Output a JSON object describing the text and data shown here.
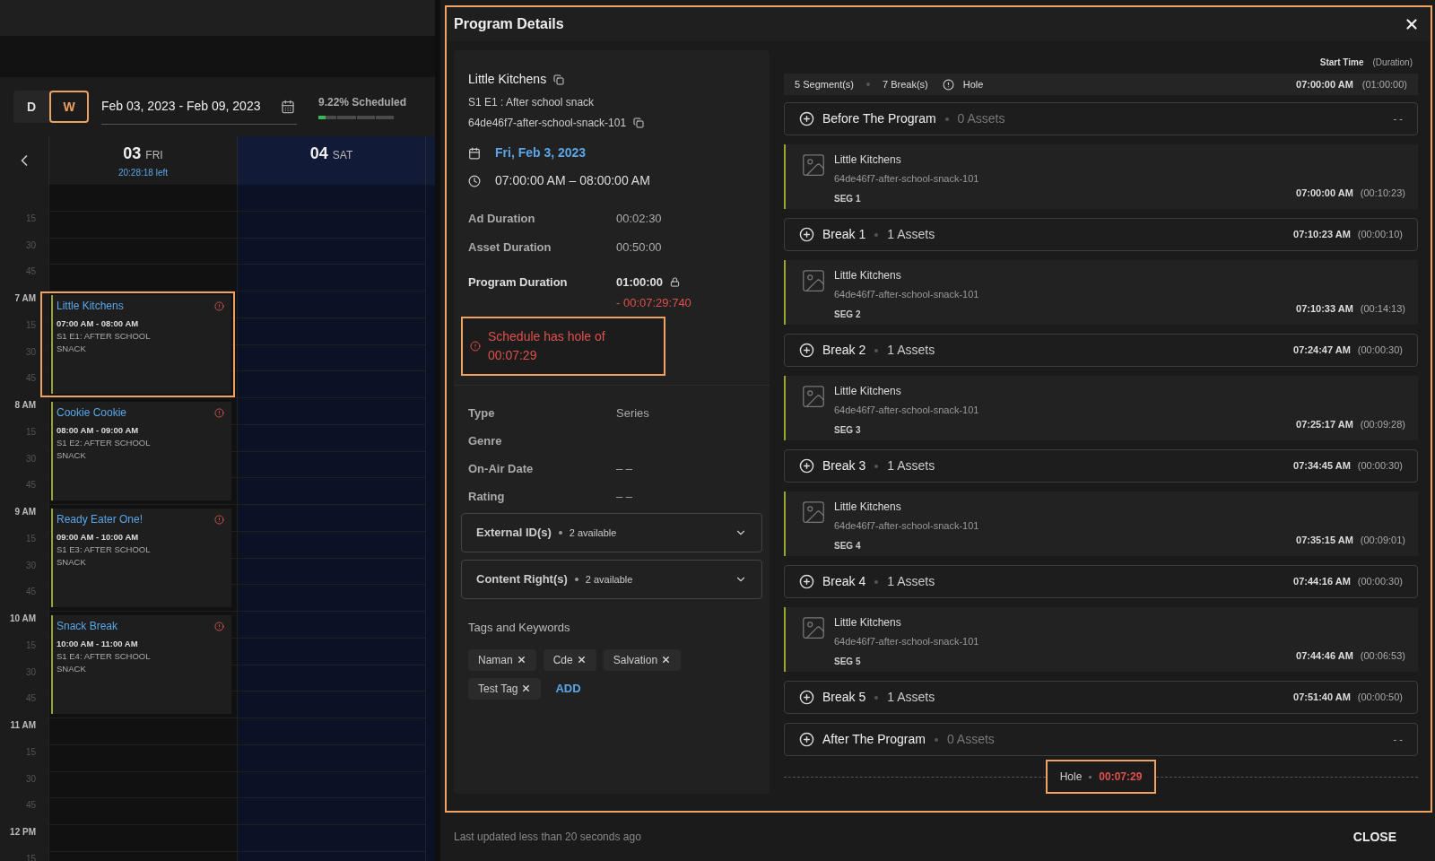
{
  "calendar": {
    "view_toggle": [
      {
        "label": "D",
        "selected": false
      },
      {
        "label": "W",
        "selected": true
      }
    ],
    "date_range": "Feb 03, 2023 - Feb 09, 2023",
    "scheduled": {
      "label": "9.22% Scheduled",
      "level": 0.0922
    },
    "days": [
      {
        "number": "03",
        "weekday": "FRI",
        "remaining": "20:28:18 left",
        "selected": false
      },
      {
        "number": "04",
        "weekday": "SAT",
        "selected": true
      }
    ],
    "time_labels": [
      "15",
      "30",
      "45",
      "7 AM",
      "15",
      "30",
      "45",
      "8 AM",
      "15",
      "30",
      "45",
      "9 AM",
      "15",
      "30",
      "45",
      "10 AM",
      "15",
      "30",
      "45",
      "11 AM",
      "15",
      "30",
      "45",
      "12 PM",
      "15"
    ],
    "events": [
      {
        "title": "Little Kitchens",
        "time": "07:00 AM - 08:00 AM",
        "episode": "S1 E1: AFTER SCHOOL SNACK",
        "highlighted": true
      },
      {
        "title": "Cookie Cookie",
        "time": "08:00 AM - 09:00 AM",
        "episode": "S1 E2: AFTER SCHOOL SNACK",
        "highlighted": false
      },
      {
        "title": "Ready Eater One!",
        "time": "09:00 AM - 10:00 AM",
        "episode": "S1 E3: AFTER SCHOOL SNACK",
        "highlighted": false
      },
      {
        "title": "Snack Break",
        "time": "10:00 AM - 11:00 AM",
        "episode": "S1 E4: AFTER SCHOOL SNACK",
        "highlighted": false
      }
    ]
  },
  "dialog": {
    "title": "Program Details",
    "program": {
      "title": "Little Kitchens",
      "episode": "S1 E1 : After school snack",
      "asset_id": "64de46f7-after-school-snack-101",
      "date": "Fri, Feb 3, 2023",
      "time_range": "07:00:00 AM – 08:00:00 AM"
    },
    "durations": [
      {
        "label": "Ad Duration",
        "value": "00:02:30"
      },
      {
        "label": "Asset Duration",
        "value": "00:50:00"
      }
    ],
    "program_duration": {
      "label": "Program Duration",
      "value": "01:00:00",
      "locked": true,
      "difference": "- 00:07:29:740"
    },
    "error": "Schedule has hole of 00:07:29",
    "metadata": [
      {
        "label": "Type",
        "value": "Series"
      },
      {
        "label": "Genre"
      },
      {
        "label": "On-Air Date",
        "value": "– –"
      },
      {
        "label": "Rating",
        "value": "– –"
      }
    ],
    "accordions": [
      {
        "title": "External ID(s)",
        "count": "2 available",
        "expanded": false
      },
      {
        "title": "Content Right(s)",
        "count": "2 available",
        "expanded": false
      }
    ],
    "tags_title": "Tags and Keywords",
    "tags": [
      "Naman",
      "Cde",
      "Salvation",
      "Test Tag"
    ],
    "add_tag": "ADD",
    "column_headers": {
      "start": "Start Time",
      "duration": "(Duration)"
    },
    "summary": {
      "segments": "5 Segment(s)",
      "breaks": "7 Break(s)",
      "hole": "Hole",
      "start": "07:00:00 AM",
      "duration": "(01:00:00)"
    },
    "items": [
      {
        "kind": "break",
        "title": "Before The Program",
        "assets": "0 Assets",
        "empty": true,
        "start": "- -"
      },
      {
        "kind": "segment",
        "title": "Little Kitchens",
        "asset_id": "64de46f7-after-school-snack-101",
        "label": "SEG 1",
        "start": "07:00:00 AM",
        "duration": "(00:10:23)"
      },
      {
        "kind": "break",
        "title": "Break 1",
        "assets": "1 Assets",
        "empty": false,
        "start": "07:10:23 AM",
        "duration": "(00:00:10)"
      },
      {
        "kind": "segment",
        "title": "Little Kitchens",
        "asset_id": "64de46f7-after-school-snack-101",
        "label": "SEG 2",
        "start": "07:10:33 AM",
        "duration": "(00:14:13)"
      },
      {
        "kind": "break",
        "title": "Break 2",
        "assets": "1 Assets",
        "empty": false,
        "start": "07:24:47 AM",
        "duration": "(00:00:30)"
      },
      {
        "kind": "segment",
        "title": "Little Kitchens",
        "asset_id": "64de46f7-after-school-snack-101",
        "label": "SEG 3",
        "start": "07:25:17 AM",
        "duration": "(00:09:28)"
      },
      {
        "kind": "break",
        "title": "Break 3",
        "assets": "1 Assets",
        "empty": false,
        "start": "07:34:45 AM",
        "duration": "(00:00:30)"
      },
      {
        "kind": "segment",
        "title": "Little Kitchens",
        "asset_id": "64de46f7-after-school-snack-101",
        "label": "SEG 4",
        "start": "07:35:15 AM",
        "duration": "(00:09:01)"
      },
      {
        "kind": "break",
        "title": "Break 4",
        "assets": "1 Assets",
        "empty": false,
        "start": "07:44:16 AM",
        "duration": "(00:00:30)"
      },
      {
        "kind": "segment",
        "title": "Little Kitchens",
        "asset_id": "64de46f7-after-school-snack-101",
        "label": "SEG 5",
        "start": "07:44:46 AM",
        "duration": "(00:06:53)"
      },
      {
        "kind": "break",
        "title": "Break 5",
        "assets": "1 Assets",
        "empty": false,
        "start": "07:51:40 AM",
        "duration": "(00:00:50)"
      },
      {
        "kind": "break",
        "title": "After The Program",
        "assets": "0 Assets",
        "empty": true,
        "start": "- -"
      }
    ],
    "hole": {
      "label": "Hole",
      "value": "00:07:29"
    },
    "last_updated": "Last updated less than 20 seconds ago",
    "close_button": "CLOSE"
  }
}
